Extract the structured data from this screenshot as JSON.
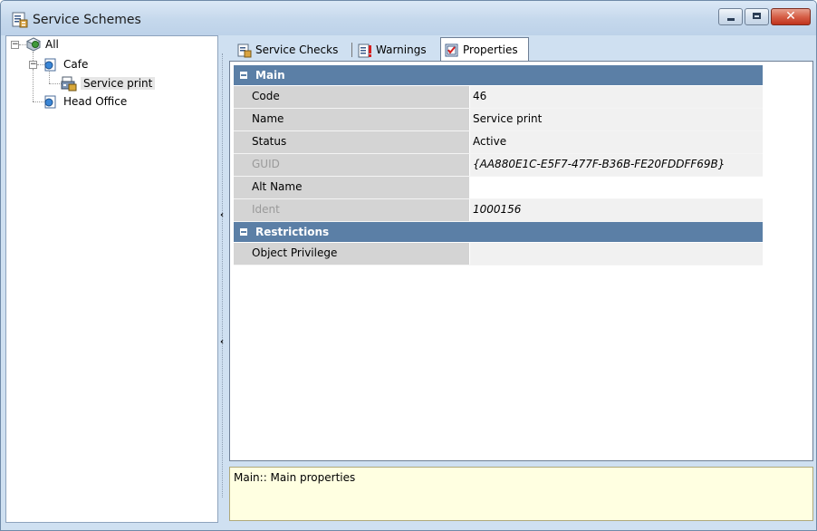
{
  "window": {
    "title": "Service Schemes",
    "title_icon": "properties-sheet-icon"
  },
  "tree": {
    "nodes": [
      {
        "label": "All",
        "icon": "globe-cube-icon",
        "expanded": true
      },
      {
        "label": "Cafe",
        "icon": "building-icon",
        "expanded": true
      },
      {
        "label": "Service print",
        "icon": "printer-calc-icon",
        "selected": true
      },
      {
        "label": "Head Office",
        "icon": "building-icon"
      }
    ]
  },
  "tabs": [
    {
      "label": "Service Checks",
      "icon": "service-checks-icon"
    },
    {
      "label": "Warnings",
      "icon": "warnings-icon"
    },
    {
      "label": "Properties",
      "icon": "properties-icon",
      "active": true
    }
  ],
  "properties": {
    "main": {
      "label": "Main",
      "rows": [
        {
          "key": "Code",
          "value": "46"
        },
        {
          "key": "Name",
          "value": "Service print"
        },
        {
          "key": "Status",
          "value": "Active"
        },
        {
          "key": "GUID",
          "value": "{AA880E1C-E5F7-477F-B36B-FE20FDDFF69B}",
          "readonly": true
        },
        {
          "key": "Alt Name",
          "value": ""
        },
        {
          "key": "Ident",
          "value": "1000156",
          "readonly": true
        }
      ]
    },
    "restrictions": {
      "label": "Restrictions",
      "rows": [
        {
          "key": "Object Privilege",
          "value": ""
        }
      ]
    }
  },
  "description": "Main:: Main properties",
  "colors": {
    "category_header": "#5b7fa6",
    "key_cell": "#d4d4d4",
    "description_bg": "#ffffe1"
  }
}
